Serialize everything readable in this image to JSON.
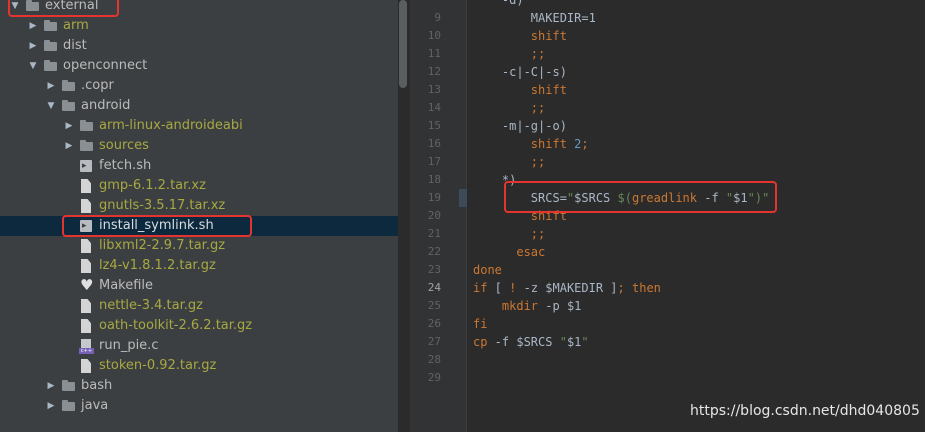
{
  "tree": {
    "items": [
      {
        "label": "external",
        "depth": 0,
        "arrow": "down",
        "icon": "folder-icon",
        "color": "normal",
        "highlighted": true
      },
      {
        "label": "arm",
        "depth": 1,
        "arrow": "right",
        "icon": "folder-icon",
        "color": "ignored"
      },
      {
        "label": "dist",
        "depth": 1,
        "arrow": "right",
        "icon": "folder-icon",
        "color": "normal"
      },
      {
        "label": "openconnect",
        "depth": 1,
        "arrow": "down",
        "icon": "folder-icon",
        "color": "normal"
      },
      {
        "label": ".copr",
        "depth": 2,
        "arrow": "right",
        "icon": "folder-icon",
        "color": "normal"
      },
      {
        "label": "android",
        "depth": 2,
        "arrow": "down",
        "icon": "folder-icon",
        "color": "normal"
      },
      {
        "label": "arm-linux-androideabi",
        "depth": 3,
        "arrow": "right",
        "icon": "folder-icon",
        "color": "ignored"
      },
      {
        "label": "sources",
        "depth": 3,
        "arrow": "right",
        "icon": "folder-icon",
        "color": "ignored"
      },
      {
        "label": "fetch.sh",
        "depth": 3,
        "arrow": "",
        "icon": "shell-script-icon",
        "color": "normal"
      },
      {
        "label": "gmp-6.1.2.tar.xz",
        "depth": 3,
        "arrow": "",
        "icon": "file-icon",
        "color": "ignored"
      },
      {
        "label": "gnutls-3.5.17.tar.xz",
        "depth": 3,
        "arrow": "",
        "icon": "file-icon",
        "color": "ignored"
      },
      {
        "label": "install_symlink.sh",
        "depth": 3,
        "arrow": "",
        "icon": "shell-script-icon",
        "color": "selected",
        "selected": true,
        "highlighted": true
      },
      {
        "label": "libxml2-2.9.7.tar.gz",
        "depth": 3,
        "arrow": "",
        "icon": "file-icon",
        "color": "ignored"
      },
      {
        "label": "lz4-v1.8.1.2.tar.gz",
        "depth": 3,
        "arrow": "",
        "icon": "file-icon",
        "color": "ignored"
      },
      {
        "label": "Makefile",
        "depth": 3,
        "arrow": "",
        "icon": "makefile-icon",
        "color": "normal"
      },
      {
        "label": "nettle-3.4.tar.gz",
        "depth": 3,
        "arrow": "",
        "icon": "file-icon",
        "color": "ignored"
      },
      {
        "label": "oath-toolkit-2.6.2.tar.gz",
        "depth": 3,
        "arrow": "",
        "icon": "file-icon",
        "color": "ignored"
      },
      {
        "label": "run_pie.c",
        "depth": 3,
        "arrow": "",
        "icon": "c-file-icon",
        "color": "normal"
      },
      {
        "label": "stoken-0.92.tar.gz",
        "depth": 3,
        "arrow": "",
        "icon": "file-icon",
        "color": "ignored"
      },
      {
        "label": "bash",
        "depth": 2,
        "arrow": "right",
        "icon": "folder-icon",
        "color": "normal"
      },
      {
        "label": "java",
        "depth": 2,
        "arrow": "right",
        "icon": "folder-icon",
        "color": "normal"
      }
    ]
  },
  "editor": {
    "current_line": 24,
    "lines": [
      {
        "n": "9",
        "tokens": [
          {
            "t": "        MAKEDIR=1",
            "c": "plain"
          }
        ]
      },
      {
        "n": "10",
        "tokens": [
          {
            "t": "        shift",
            "c": "kw"
          }
        ]
      },
      {
        "n": "11",
        "tokens": [
          {
            "t": "        ;;",
            "c": "kw"
          }
        ]
      },
      {
        "n": "12",
        "tokens": [
          {
            "t": "    -c|-C|-s)",
            "c": "plain"
          }
        ]
      },
      {
        "n": "13",
        "tokens": [
          {
            "t": "        shift",
            "c": "kw"
          }
        ]
      },
      {
        "n": "14",
        "tokens": [
          {
            "t": "        ;;",
            "c": "kw"
          }
        ]
      },
      {
        "n": "15",
        "tokens": [
          {
            "t": "    -m|-g|-o)",
            "c": "plain"
          }
        ]
      },
      {
        "n": "16",
        "tokens": [
          {
            "t": "        shift ",
            "c": "kw"
          },
          {
            "t": "2",
            "c": "num"
          },
          {
            "t": ";",
            "c": "kw"
          }
        ]
      },
      {
        "n": "17",
        "tokens": [
          {
            "t": "        ;;",
            "c": "kw"
          }
        ]
      },
      {
        "n": "18",
        "tokens": [
          {
            "t": "    *)",
            "c": "plain"
          }
        ]
      },
      {
        "n": "19",
        "tokens": [
          {
            "t": "        SRCS=",
            "c": "plain"
          },
          {
            "t": "\"",
            "c": "str"
          },
          {
            "t": "$SRCS",
            "c": "plain"
          },
          {
            "t": " $(",
            "c": "str"
          },
          {
            "t": "greadlink",
            "c": "kw"
          },
          {
            "t": " -f ",
            "c": "plain"
          },
          {
            "t": "\"",
            "c": "str"
          },
          {
            "t": "$1",
            "c": "plain"
          },
          {
            "t": "\"",
            "c": "str"
          },
          {
            "t": ")",
            "c": "str"
          },
          {
            "t": "\"",
            "c": "str"
          }
        ],
        "boxed": true
      },
      {
        "n": "20",
        "tokens": [
          {
            "t": "        shift",
            "c": "kw"
          }
        ]
      },
      {
        "n": "21",
        "tokens": [
          {
            "t": "        ;;",
            "c": "kw"
          }
        ]
      },
      {
        "n": "22",
        "tokens": [
          {
            "t": "      esac",
            "c": "kw"
          }
        ]
      },
      {
        "n": "23",
        "tokens": [
          {
            "t": "done",
            "c": "kw"
          }
        ]
      },
      {
        "n": "24",
        "tokens": [
          {
            "t": "if",
            "c": "kw"
          },
          {
            "t": " [ ",
            "c": "plain"
          },
          {
            "t": "!",
            "c": "kw"
          },
          {
            "t": " -z ",
            "c": "plain"
          },
          {
            "t": "$MAKEDIR",
            "c": "plain"
          },
          {
            "t": " ]",
            "c": "plain"
          },
          {
            "t": ";",
            "c": "kw"
          },
          {
            "t": " then",
            "c": "kw"
          }
        ]
      },
      {
        "n": "25",
        "tokens": [
          {
            "t": "    mkdir",
            "c": "kw"
          },
          {
            "t": " -p ",
            "c": "plain"
          },
          {
            "t": "$1",
            "c": "plain"
          }
        ]
      },
      {
        "n": "26",
        "tokens": [
          {
            "t": "fi",
            "c": "kw"
          }
        ]
      },
      {
        "n": "27",
        "tokens": [
          {
            "t": "cp",
            "c": "kw"
          },
          {
            "t": " -f ",
            "c": "plain"
          },
          {
            "t": "$SRCS",
            "c": "plain"
          },
          {
            "t": " ",
            "c": "plain"
          },
          {
            "t": "\"",
            "c": "str"
          },
          {
            "t": "$1",
            "c": "plain"
          },
          {
            "t": "\"",
            "c": "str"
          }
        ]
      },
      {
        "n": "28",
        "tokens": []
      },
      {
        "n": "29",
        "tokens": []
      }
    ]
  },
  "watermark": "https://blog.csdn.net/dhd040805",
  "colors": {
    "tree_bg": "#3c3f41",
    "editor_bg": "#2b2b2b",
    "selection": "#0d293e",
    "highlight_box": "#e3342f",
    "keyword": "#cc7832",
    "ignored_file": "#a8a842"
  }
}
